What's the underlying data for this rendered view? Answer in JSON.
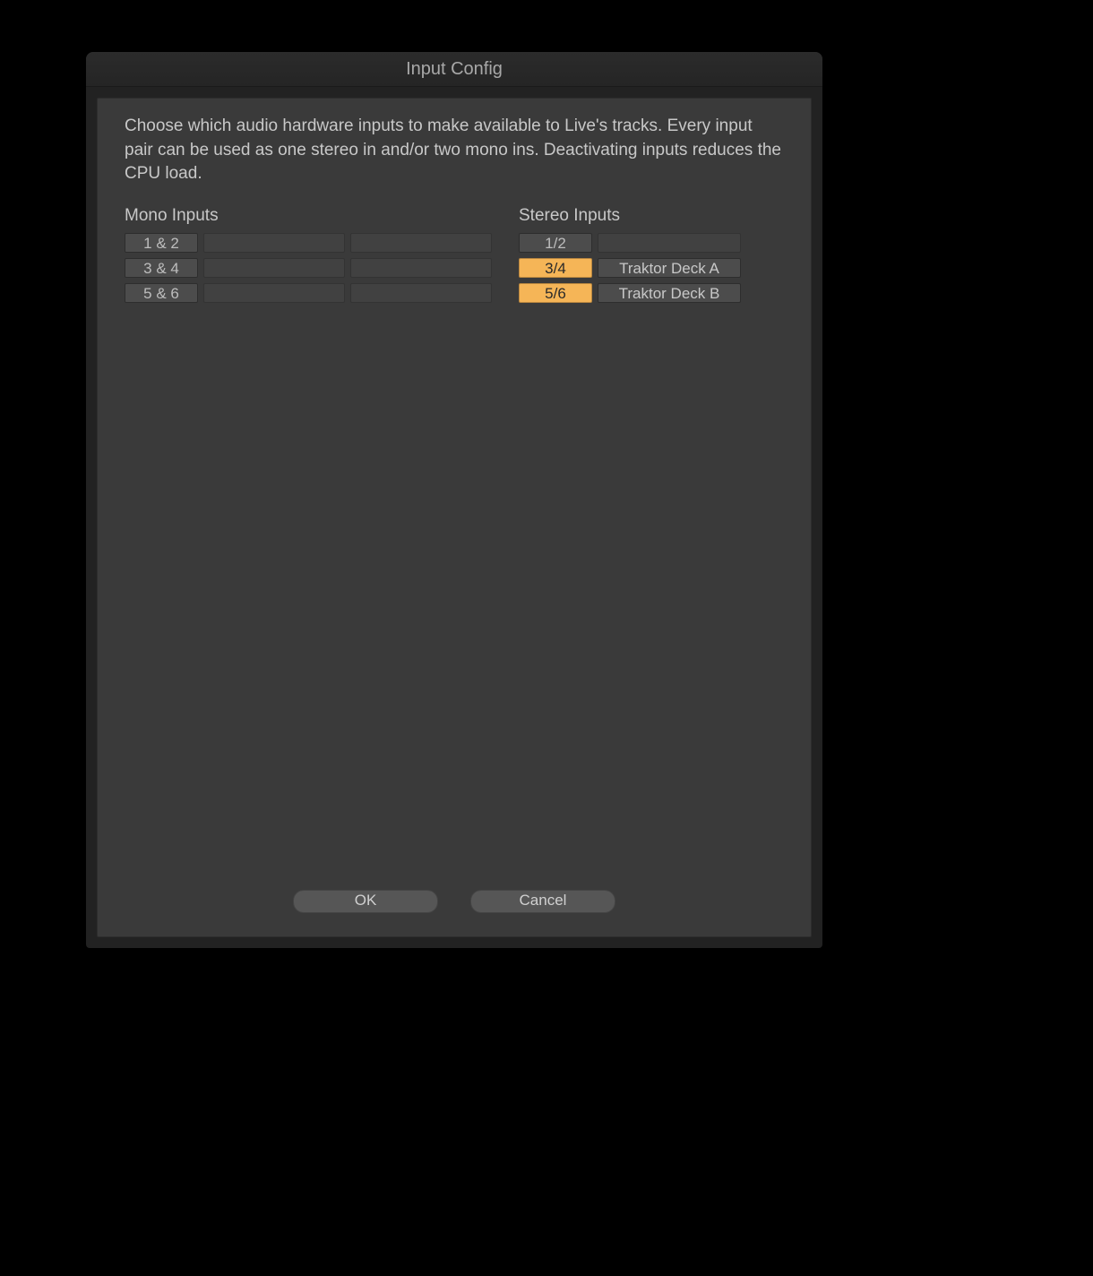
{
  "title": "Input Config",
  "help_text": "Choose which audio hardware inputs to make available to Live's tracks. Every input pair can be used as one stereo in and/or two mono ins.  Deactivating inputs reduces the CPU load.",
  "mono": {
    "heading": "Mono Inputs",
    "rows": [
      {
        "channel": "1 & 2",
        "active": false,
        "name1": "",
        "name2": ""
      },
      {
        "channel": "3 & 4",
        "active": false,
        "name1": "",
        "name2": ""
      },
      {
        "channel": "5 & 6",
        "active": false,
        "name1": "",
        "name2": ""
      }
    ]
  },
  "stereo": {
    "heading": "Stereo Inputs",
    "rows": [
      {
        "channel": "1/2",
        "active": false,
        "name": ""
      },
      {
        "channel": "3/4",
        "active": true,
        "name": "Traktor Deck A"
      },
      {
        "channel": "5/6",
        "active": true,
        "name": "Traktor Deck B"
      }
    ]
  },
  "buttons": {
    "ok": "OK",
    "cancel": "Cancel"
  },
  "colors": {
    "accent": "#f5b557",
    "panel": "#3a3a3a",
    "window": "#222222"
  }
}
